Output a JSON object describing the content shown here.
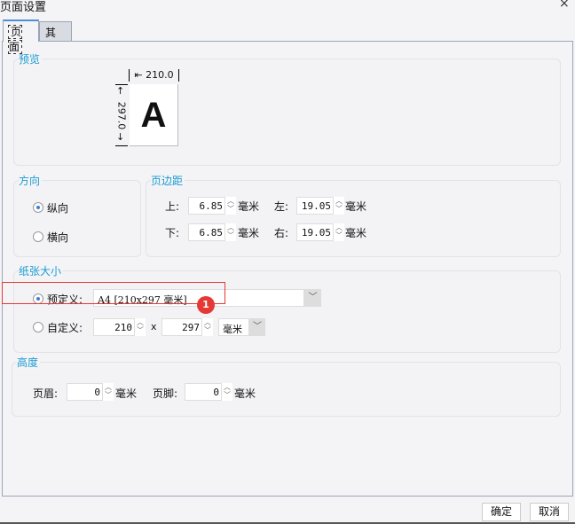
{
  "window": {
    "title": "页面设置",
    "close_icon": "×"
  },
  "tabs": [
    {
      "label": "页面",
      "active": true
    },
    {
      "label": "其他",
      "active": false
    }
  ],
  "preview": {
    "label": "预览",
    "width_label": "210.0",
    "height_label": "297.0",
    "paper_letter": "A"
  },
  "orientation": {
    "label": "方向",
    "options": [
      {
        "label": "纵向",
        "selected": true
      },
      {
        "label": "横向",
        "selected": false
      }
    ]
  },
  "margins": {
    "label": "页边距",
    "top_label": "上:",
    "top": "6.85",
    "left_label": "左:",
    "left": "19.05",
    "bottom_label": "下:",
    "bottom": "6.85",
    "right_label": "右:",
    "right": "19.05",
    "unit": "毫米"
  },
  "paper_size": {
    "label": "纸张大小",
    "predefined_label": "预定义:",
    "predefined_value": "A4 [210x297 毫米]",
    "custom_label": "自定义:",
    "custom_width": "210",
    "times": "x",
    "custom_height": "297",
    "custom_unit": "毫米",
    "badge": "1",
    "highlight_color": "#e53935"
  },
  "height": {
    "label": "高度",
    "header_label": "页眉:",
    "header": "0",
    "footer_label": "页脚:",
    "footer": "0",
    "unit": "毫米"
  },
  "buttons": {
    "ok": "确定",
    "cancel": "取消"
  }
}
